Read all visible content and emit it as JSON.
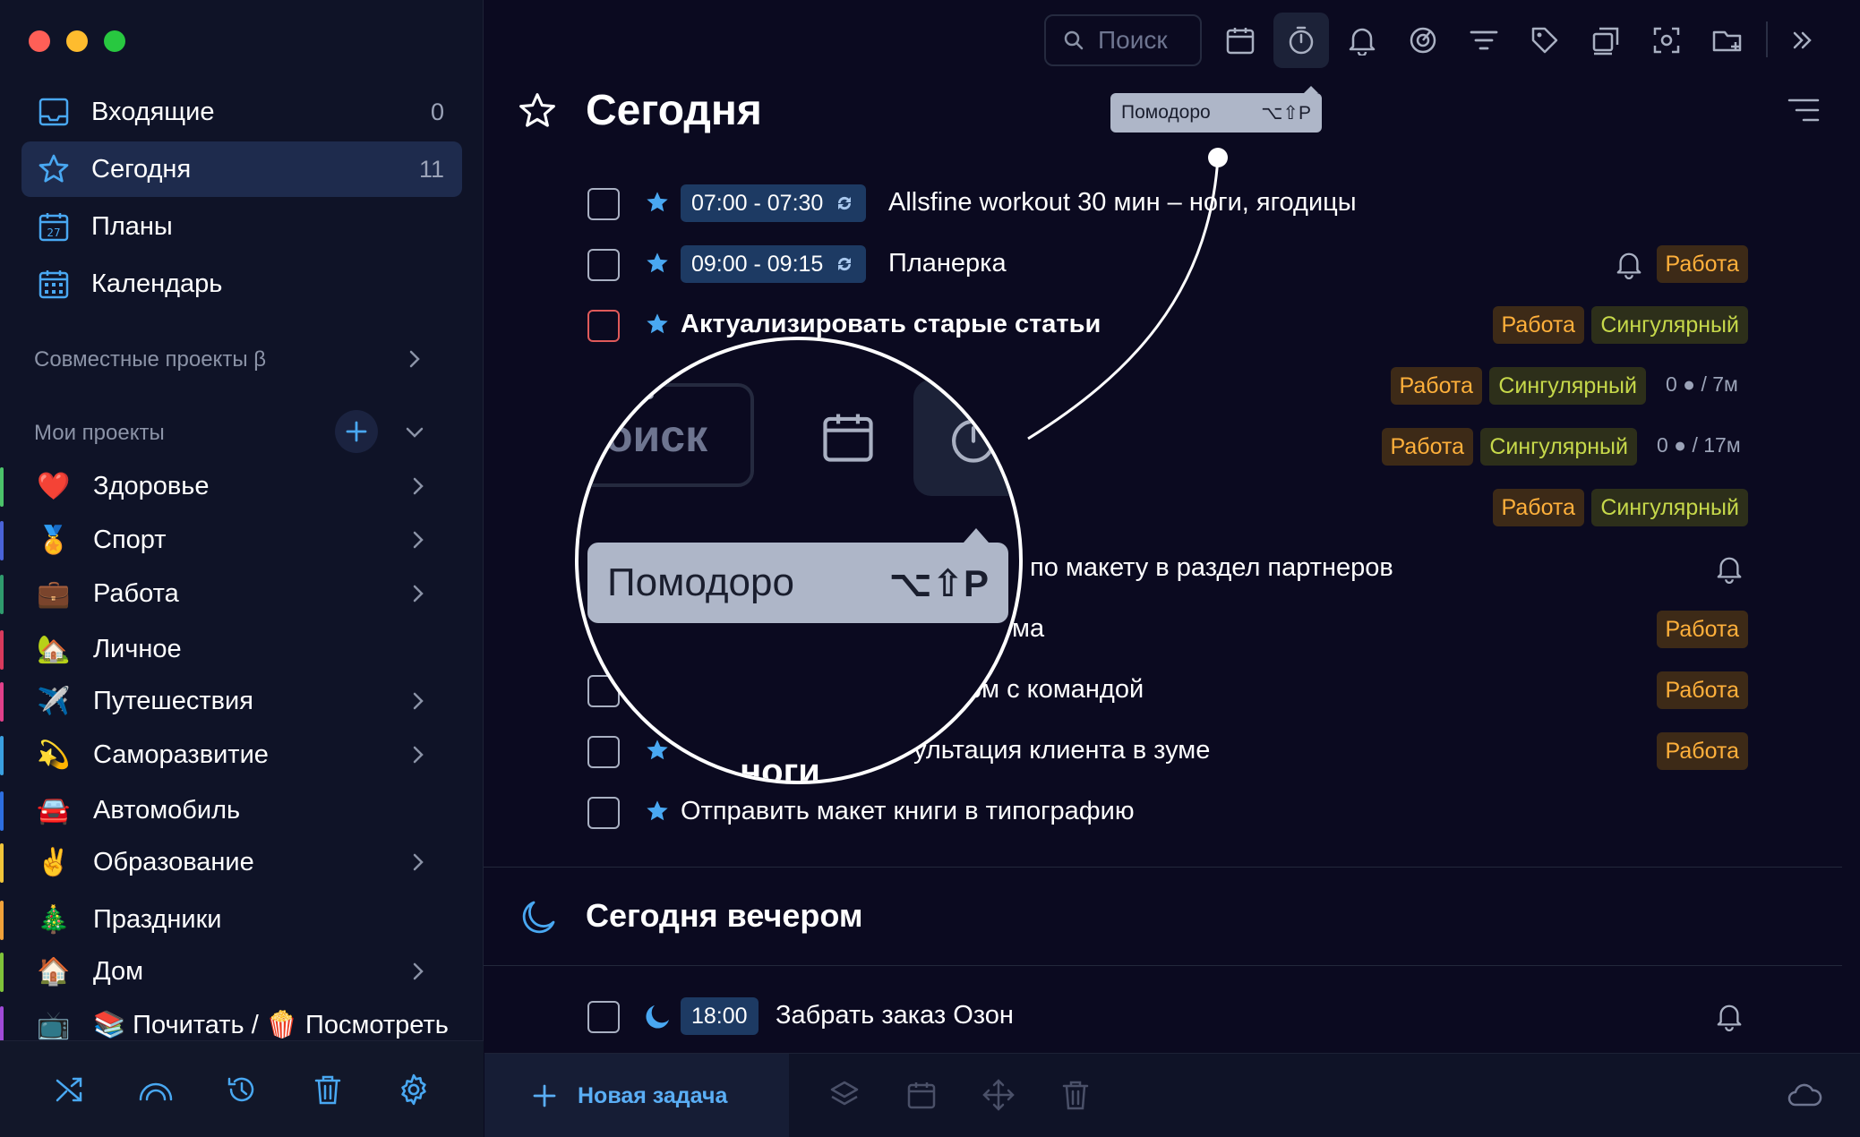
{
  "sidebar": {
    "nav": [
      {
        "label": "Входящие",
        "count": "0"
      },
      {
        "label": "Сегодня",
        "count": "11"
      },
      {
        "label": "Планы",
        "count": ""
      },
      {
        "label": "Календарь",
        "count": ""
      }
    ],
    "shared_projects": "Совместные проекты β",
    "my_projects": "Мои проекты",
    "projects": [
      {
        "emoji": "❤️",
        "label": "Здоровье",
        "color": "#4cc36a"
      },
      {
        "emoji": "🏅",
        "label": "Спорт",
        "color": "#4a63d8"
      },
      {
        "emoji": "💼",
        "label": "Работа",
        "color": "#2f9b6d"
      },
      {
        "emoji": "🏡",
        "label": "Личное",
        "color": "#d83a5c"
      },
      {
        "emoji": "✈️",
        "label": "Путешествия",
        "color": "#e0408a"
      },
      {
        "emoji": "💫",
        "label": "Саморазвитие",
        "color": "#3aa0e0"
      },
      {
        "emoji": "🚘",
        "label": "Автомобиль",
        "color": "#2d6ee0"
      },
      {
        "emoji": "✌️",
        "label": "Образование",
        "color": "#f0c53a"
      },
      {
        "emoji": "🎄",
        "label": "Праздники",
        "color": "#f0a23a"
      },
      {
        "emoji": "🏠",
        "label": "Дом",
        "color": "#7fc33a"
      },
      {
        "emoji": "📺",
        "label": "📚 Почитать / 🍿 Посмотреть",
        "color": "#a04ad8"
      }
    ]
  },
  "toolbar": {
    "search_placeholder": "Поиск"
  },
  "tooltip": {
    "label": "Помодоро",
    "shortcut": "⌥⇧P"
  },
  "page": {
    "title": "Сегодня",
    "evening_title": "Сегодня вечером"
  },
  "tasks": [
    {
      "time": "07:00 - 07:30",
      "title": "Allsfine workout 30 мин – ноги, ягодицы"
    },
    {
      "time": "09:00 - 09:15",
      "title": "Планерка",
      "tag1": "Работа"
    },
    {
      "title": "Актуализировать старые статьи",
      "tag1": "Работа",
      "tag2": "Сингулярный"
    },
    {
      "tag1": "Работа",
      "tag2": "Сингулярный",
      "meta": "0 ● / 7м"
    },
    {
      "tag1": "Работа",
      "tag2": "Сингулярный",
      "meta": "0 ● / 17м"
    },
    {
      "tag1": "Работа",
      "tag2": "Сингулярный"
    },
    {
      "title": "по макету в раздел партнеров"
    },
    {
      "title": "ма",
      "tag1": "Работа"
    },
    {
      "title": "рм с командой",
      "tag1": "Работа"
    },
    {
      "title": "ультация клиента в зуме",
      "tag1": "Работа"
    },
    {
      "title": "Отправить макет книги в типографию"
    }
  ],
  "evening_tasks": [
    {
      "time": "18:00",
      "title": "Забрать заказ Озон"
    }
  ],
  "magnifier": {
    "search_fragment": "оиск",
    "bottom_fragment": "ноги"
  },
  "bottom": {
    "new_task": "Новая задача"
  }
}
